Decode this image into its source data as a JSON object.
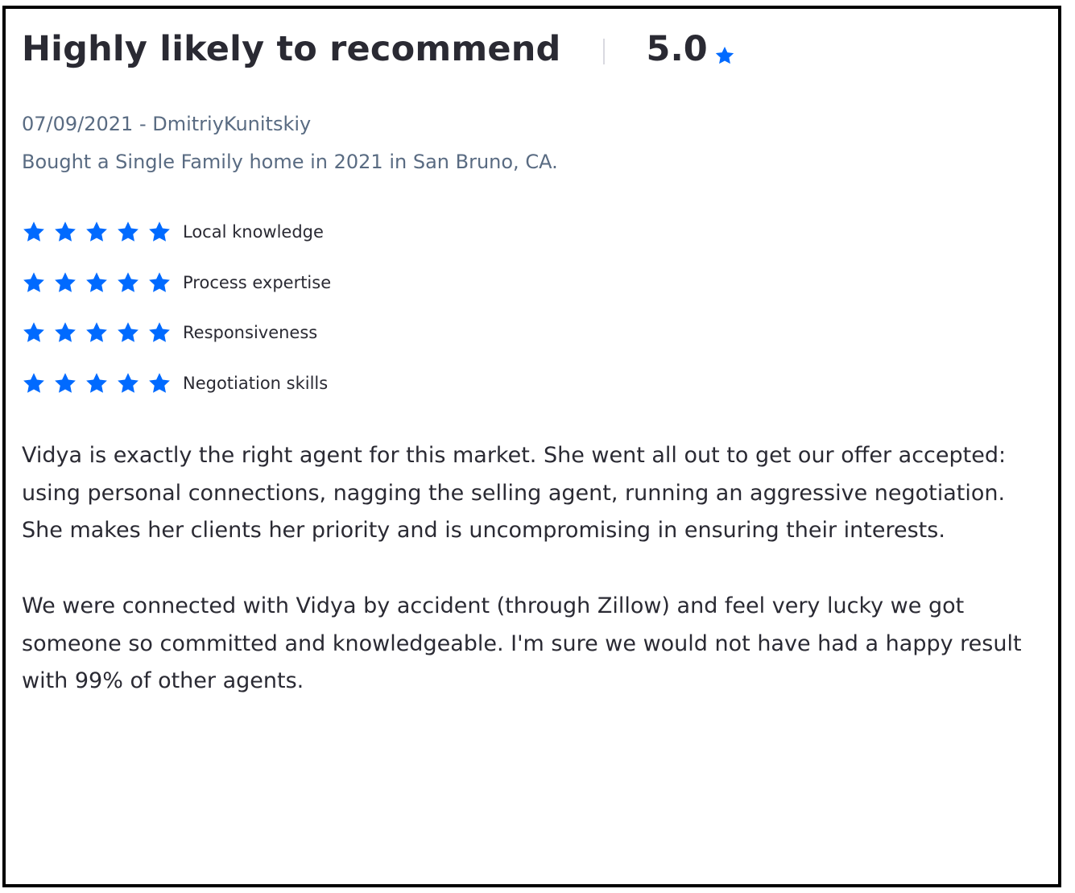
{
  "review": {
    "title": "Highly likely to recommend",
    "score": "5.0",
    "date_author": "07/09/2021 - DmitriyKunitskiy",
    "purchase_info": "Bought a Single Family home in 2021 in San Bruno, CA.",
    "ratings": [
      {
        "label": "Local knowledge",
        "stars": 5
      },
      {
        "label": "Process expertise",
        "stars": 5
      },
      {
        "label": "Responsiveness",
        "stars": 5
      },
      {
        "label": "Negotiation skills",
        "stars": 5
      }
    ],
    "paragraphs": [
      "Vidya is exactly the right agent for this market. She went all out to get our offer accepted: using personal connections, nagging the selling agent, running an aggressive negotiation. She makes her clients her priority and is uncompromising in ensuring their interests.",
      "We were connected with Vidya by accident (through Zillow) and feel very lucky we got someone so committed and knowledgeable. I'm sure we would not have had a happy result with 99% of other agents."
    ]
  },
  "colors": {
    "star": "#006aff",
    "title": "#2a2a33",
    "meta": "#596b82",
    "divider": "#d9d9e0"
  },
  "icons": {
    "star": "star-icon"
  }
}
